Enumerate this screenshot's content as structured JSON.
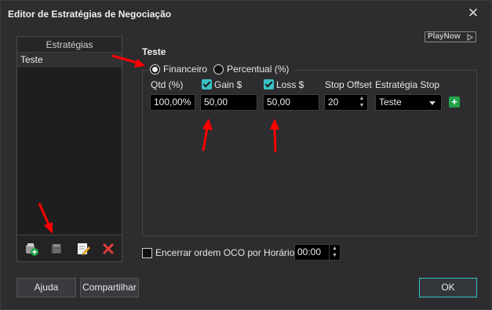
{
  "window": {
    "title": "Editor de Estratégias de Negociação",
    "close_glyph": "✕"
  },
  "strategies": {
    "header": "Estratégias",
    "items": [
      {
        "label": "Teste"
      }
    ],
    "tools": [
      "add-strategy-icon",
      "save-icon",
      "edit-icon",
      "delete-icon"
    ]
  },
  "playnow": {
    "label": "PlayNow"
  },
  "editor": {
    "name": "Teste",
    "mode": {
      "options": [
        {
          "label": "Financeiro",
          "selected": true
        },
        {
          "label": "Percentual (%)",
          "selected": false
        }
      ]
    },
    "columns": {
      "qtd_label": "Qtd (%)",
      "gain_label": "Gain $",
      "loss_label": "Loss $",
      "stop_offset_label": "Stop Offset",
      "stop_strategy_label": "Estratégia Stop"
    },
    "values": {
      "qtd": "100,00%",
      "gain": "50,00",
      "loss": "50,00",
      "stop_offset": "20",
      "stop_strategy": "Teste"
    },
    "gain_checked": true,
    "loss_checked": true,
    "add_glyph": "+"
  },
  "oco": {
    "label": "Encerrar ordem OCO por Horário",
    "checked": false,
    "time": "00:00",
    "info_glyph": "i"
  },
  "buttons": {
    "help": "Ajuda",
    "share": "Compartilhar",
    "ok": "OK"
  },
  "colors": {
    "accent": "#39c1c4",
    "add_green": "#22a24a",
    "annotation_red": "#ff0000"
  }
}
